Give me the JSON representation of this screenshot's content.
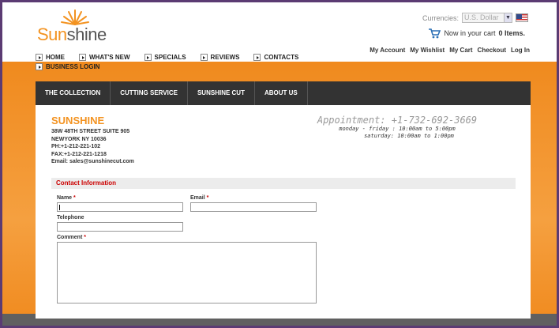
{
  "logo": {
    "text_a": "Sun",
    "text_b": "shine"
  },
  "header": {
    "currency_label": "Currencies:",
    "currency_value": "U.S. Dollar",
    "cart_text_pre": "Now in your cart",
    "cart_count": "0 Items.",
    "account_links": [
      "My Account",
      "My Wishlist",
      "My Cart",
      "Checkout",
      "Log In"
    ]
  },
  "nav": {
    "row1": [
      "HOME",
      "WHAT'S NEW",
      "SPECIALS",
      "REVIEWS",
      "CONTACTS"
    ],
    "row2": [
      "BUSINESS LOGIN"
    ]
  },
  "menu": [
    "THE COLLECTION",
    "CUTTING SERVICE",
    "SUNSHINE CUT",
    "ABOUT US"
  ],
  "store": {
    "name": "SUNSHINE",
    "address1": "38W 48TH STREET SUITE 905",
    "address2": "NEWYORK NY 10036",
    "phone": "PH:+1-212-221-102",
    "fax": "FAX:+1-212-221-1218",
    "email": "Email: sales@sunshinecut.com"
  },
  "appointment": {
    "title": "Appointment: +1-732-692-3669",
    "line1": "monday - friday : 10:00am to 5:00pm",
    "line2": "saturday: 10:00am to 1:00pm"
  },
  "form": {
    "section_title": "Contact Information",
    "name_label": "Name",
    "email_label": "Email",
    "telephone_label": "Telephone",
    "comment_label": "Comment",
    "required_mark": "*"
  },
  "colors": {
    "accent": "#f39321",
    "menu_bg": "#333333",
    "required": "#cc0000"
  }
}
